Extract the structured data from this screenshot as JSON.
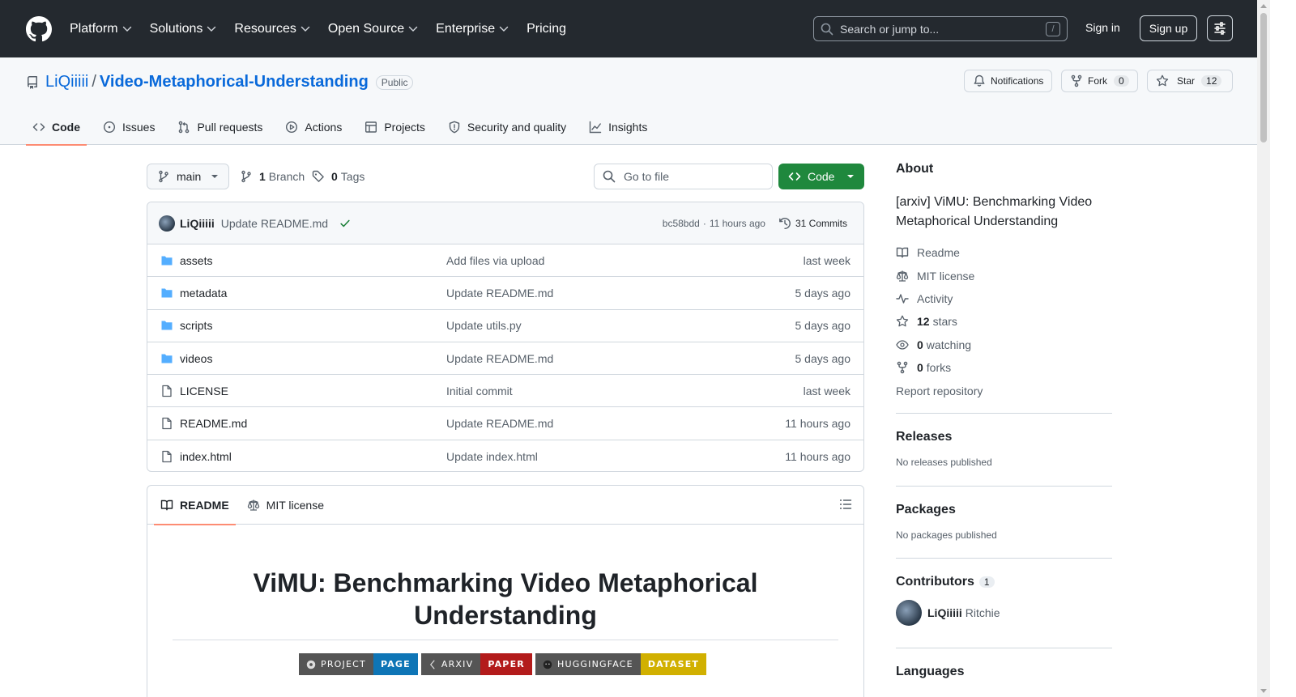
{
  "header": {
    "nav": [
      {
        "label": "Platform",
        "dropdown": true
      },
      {
        "label": "Solutions",
        "dropdown": true
      },
      {
        "label": "Resources",
        "dropdown": true
      },
      {
        "label": "Open Source",
        "dropdown": true
      },
      {
        "label": "Enterprise",
        "dropdown": true
      },
      {
        "label": "Pricing",
        "dropdown": false
      }
    ],
    "search_placeholder": "Search or jump to...",
    "search_shortcut": "/",
    "signin": "Sign in",
    "signup": "Sign up"
  },
  "repo": {
    "owner": "LiQiiiii",
    "separator": "/",
    "name": "Video-Metaphorical-Understanding",
    "visibility": "Public",
    "notifications_label": "Notifications",
    "fork_label": "Fork",
    "fork_count": "0",
    "star_label": "Star",
    "star_count": "12",
    "tabs": [
      {
        "label": "Code",
        "icon": "code-icon"
      },
      {
        "label": "Issues",
        "icon": "issue-icon"
      },
      {
        "label": "Pull requests",
        "icon": "pull-request-icon"
      },
      {
        "label": "Actions",
        "icon": "play-icon"
      },
      {
        "label": "Projects",
        "icon": "table-icon"
      },
      {
        "label": "Security and quality",
        "icon": "shield-icon"
      },
      {
        "label": "Insights",
        "icon": "graph-icon"
      }
    ]
  },
  "toolbar": {
    "branch": "main",
    "branch_count": "1",
    "branch_label": "Branch",
    "tag_count": "0",
    "tag_label": "Tags",
    "goto_placeholder": "Go to file",
    "code_button": "Code"
  },
  "last_commit": {
    "author": "LiQiiiii",
    "message": "Update README.md",
    "sha": "bc58bdd",
    "dot": "·",
    "time": "11 hours ago",
    "commits": "31 Commits"
  },
  "files": [
    {
      "type": "dir",
      "name": "assets",
      "message": "Add files via upload",
      "time": "last week"
    },
    {
      "type": "dir",
      "name": "metadata",
      "message": "Update README.md",
      "time": "5 days ago"
    },
    {
      "type": "dir",
      "name": "scripts",
      "message": "Update utils.py",
      "time": "5 days ago"
    },
    {
      "type": "dir",
      "name": "videos",
      "message": "Update README.md",
      "time": "5 days ago"
    },
    {
      "type": "file",
      "name": "LICENSE",
      "message": "Initial commit",
      "time": "last week"
    },
    {
      "type": "file",
      "name": "README.md",
      "message": "Update README.md",
      "time": "11 hours ago"
    },
    {
      "type": "file",
      "name": "index.html",
      "message": "Update index.html",
      "time": "11 hours ago"
    }
  ],
  "readme": {
    "tab_readme": "README",
    "tab_license": "MIT license",
    "title_line1": "ViMU: Benchmarking Video Metaphorical",
    "title_line2": "Understanding",
    "shields": [
      {
        "left": "PROJECT",
        "right": "PAGE",
        "color": "#0e75b6"
      },
      {
        "left": "ARXIV",
        "right": "PAPER",
        "color": "#b31b1b"
      },
      {
        "left": "HUGGINGFACE",
        "right": "DATASET",
        "color": "#d1b000"
      }
    ]
  },
  "sidebar": {
    "about_title": "About",
    "description": "[arxiv] ViMU: Benchmarking Video Metaphorical Understanding",
    "readme": "Readme",
    "license": "MIT license",
    "activity": "Activity",
    "stars_count": "12",
    "stars_label": "stars",
    "watching_count": "0",
    "watching_label": "watching",
    "forks_count": "0",
    "forks_label": "forks",
    "report": "Report repository",
    "releases_title": "Releases",
    "releases_empty": "No releases published",
    "packages_title": "Packages",
    "packages_empty": "No packages published",
    "contributors_title": "Contributors",
    "contributors_count": "1",
    "contributor_login": "LiQiiiii",
    "contributor_name": "Ritchie",
    "languages_title": "Languages"
  },
  "colors": {
    "header_bg": "#24292f",
    "link": "#0969da",
    "primary_button": "#1f883d",
    "tab_underline": "#fd8c73",
    "folder": "#54aeff"
  }
}
